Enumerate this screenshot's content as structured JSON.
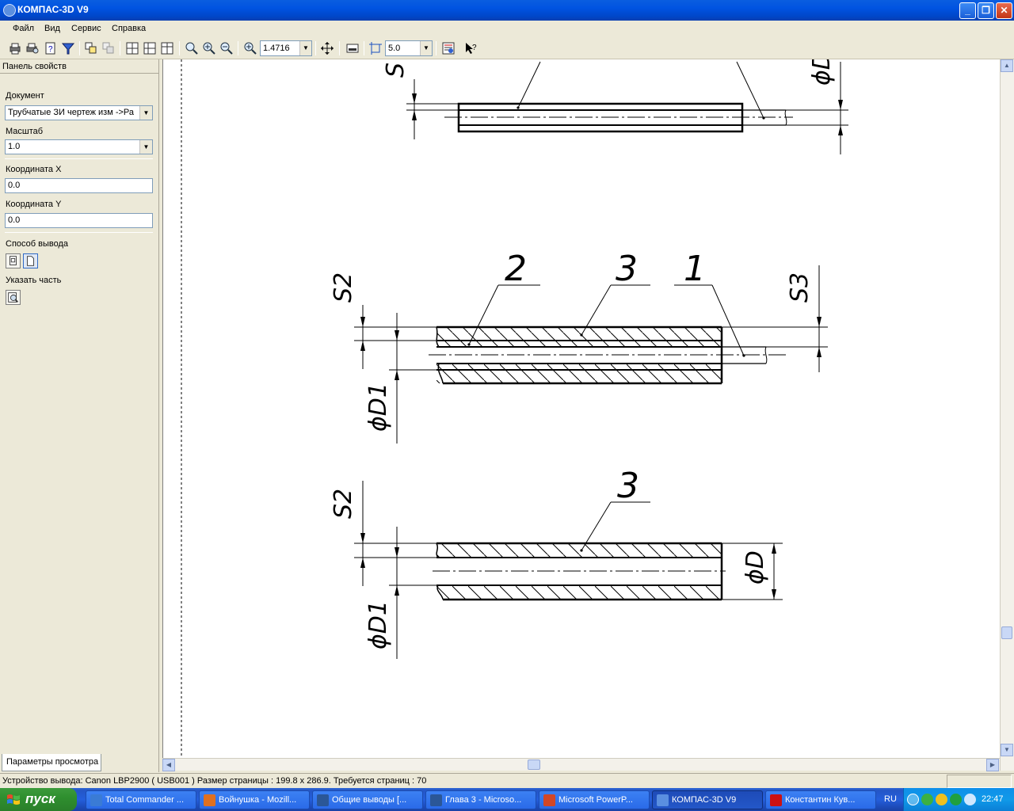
{
  "window": {
    "title": "КОМПАС-3D V9"
  },
  "menu": {
    "file": "Файл",
    "view": "Вид",
    "service": "Сервис",
    "help": "Справка"
  },
  "toolbar": {
    "zoom_value": "1.4716",
    "step_value": "5.0"
  },
  "panel": {
    "header": "Панель свойств",
    "document_label": "Документ",
    "document_value": "Трубчатые ЗИ чертеж изм ->Ра",
    "scale_label": "Масштаб",
    "scale_value": "1.0",
    "coord_x_label": "Координата X",
    "coord_x_value": "0.0",
    "coord_y_label": "Координата Y",
    "coord_y_value": "0.0",
    "output_label": "Способ вывода",
    "part_label": "Указать часть",
    "bottom_tab": "Параметры просмотра"
  },
  "drawing": {
    "top_dim_s": "S",
    "top_dim_d": "ϕD",
    "mid_leader_2": "2",
    "mid_leader_3": "3",
    "mid_leader_1": "1",
    "mid_dim_s2": "S2",
    "mid_dim_s3": "S3",
    "mid_dim_d1": "ϕD1",
    "bot_leader_3": "3",
    "bot_dim_s2": "S2",
    "bot_dim_d": "ϕD",
    "bot_dim_d1": "ϕD1"
  },
  "status": {
    "text": "Устройство вывода: Canon LBP2900 ( USB001 )  Размер страницы : 199.8 x 286.9.  Требуется страниц : 70"
  },
  "taskbar": {
    "start": "пуск",
    "tasks": [
      {
        "label": "Total Commander ...",
        "icon_color": "#3a7bd5"
      },
      {
        "label": "Войнушка - Mozill...",
        "icon_color": "#e07020"
      },
      {
        "label": "Общие выводы [...",
        "icon_color": "#2b5797"
      },
      {
        "label": "Глава 3 - Microso...",
        "icon_color": "#2b5797"
      },
      {
        "label": "Microsoft PowerP...",
        "icon_color": "#d24726"
      },
      {
        "label": "КОМПАС-3D V9",
        "icon_color": "#5a8fe0"
      },
      {
        "label": "Константин Кув...",
        "icon_color": "#cc1111"
      }
    ],
    "lang": "RU",
    "clock": "22:47"
  }
}
